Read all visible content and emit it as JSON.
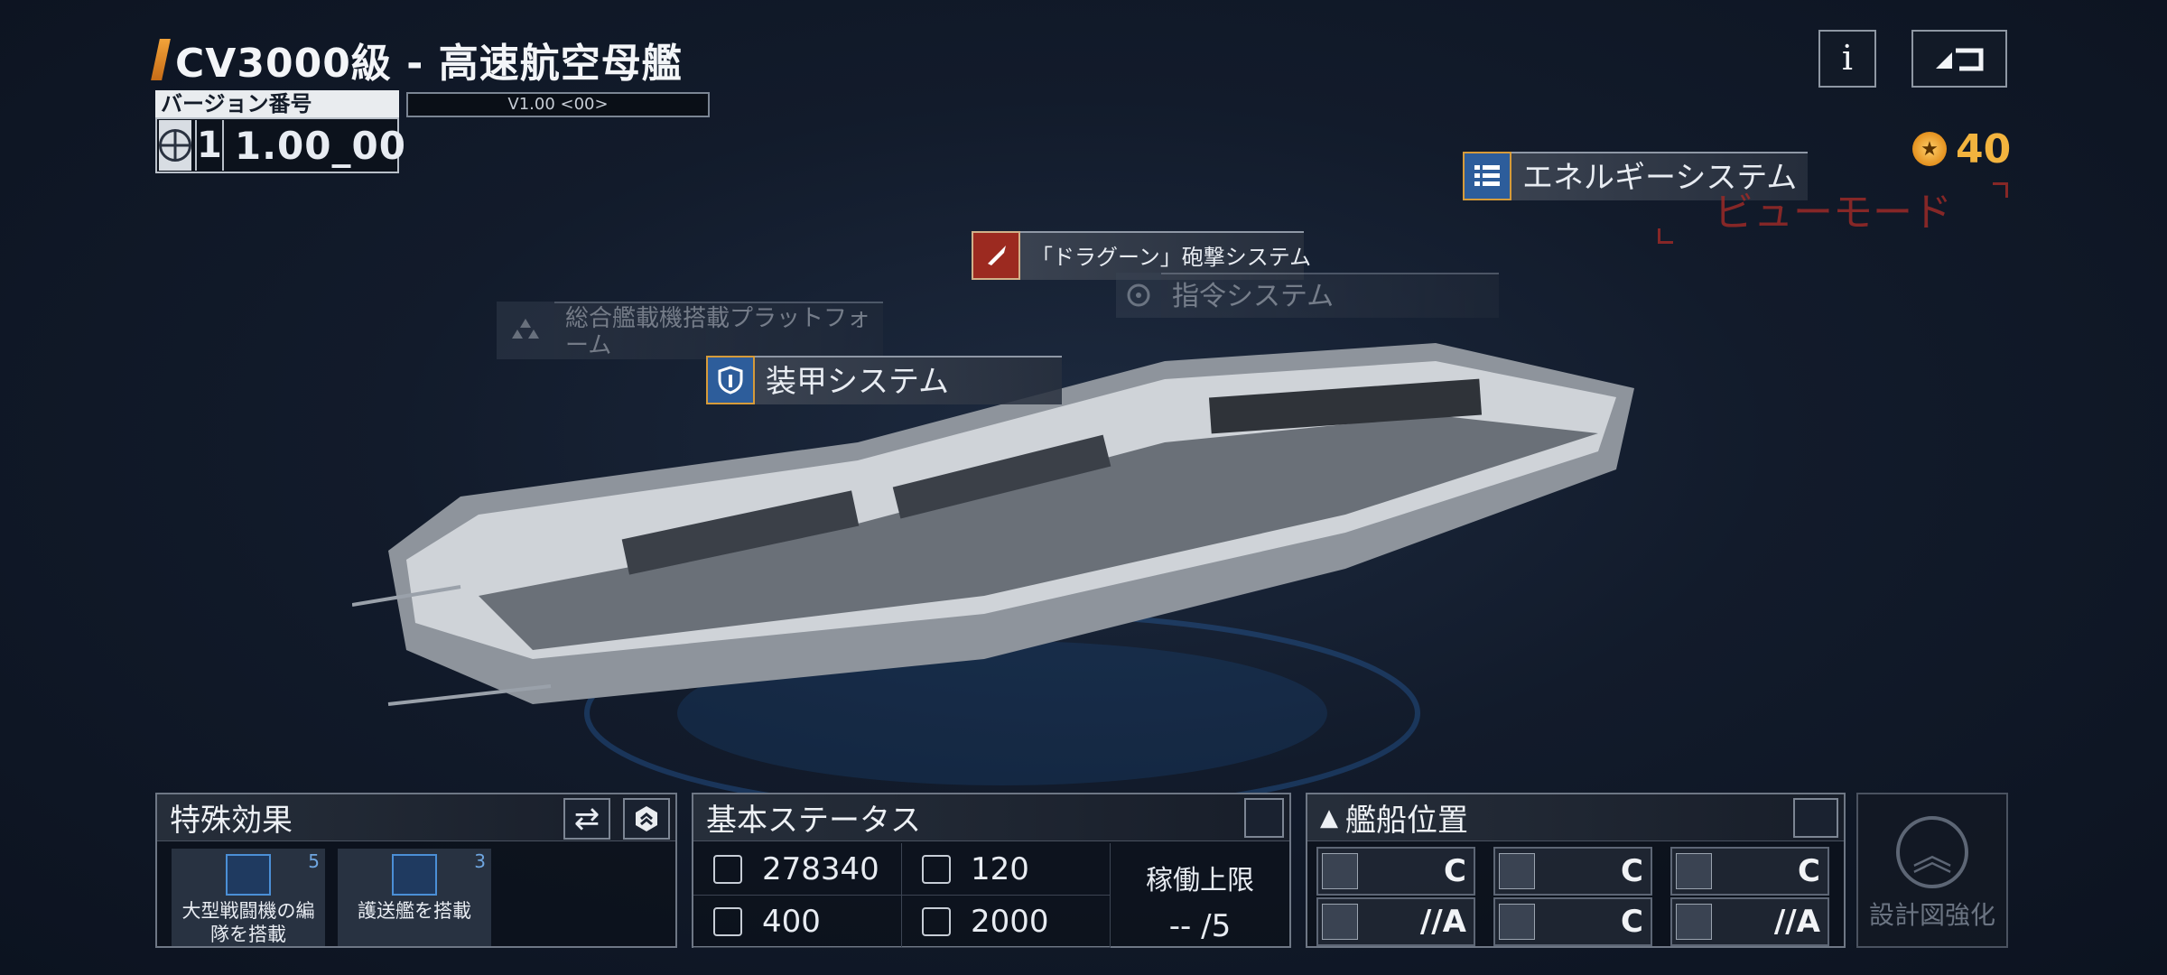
{
  "header": {
    "title": "CV3000級 - 高速航空母艦",
    "version_label": "バージョン番号",
    "version_major": "1",
    "version_minor": "1.00_00",
    "version_small": "V1.00 <00>"
  },
  "top_right": {
    "info_label": "i",
    "points": "40"
  },
  "callouts": {
    "energy": "エネルギーシステム",
    "dragoon": "「ドラグーン」砲撃システム",
    "command": "指令システム",
    "platform": "総合艦載機搭載プラットフォーム",
    "armor": "装甲システム"
  },
  "view_mode": "ビューモード",
  "special": {
    "title": "特殊効果",
    "effects": [
      {
        "count": "5",
        "text": "大型戦闘機の編隊を搭載"
      },
      {
        "count": "3",
        "text": "護送艦を搭載"
      }
    ]
  },
  "status": {
    "title": "基本ステータス",
    "hp": "278340",
    "speed": "120",
    "stat3": "400",
    "stat4": "2000",
    "op_limit_label": "稼働上限",
    "op_limit_value": "-- /5"
  },
  "position": {
    "title": "艦船位置",
    "grades": [
      "C",
      "C",
      "C",
      "//A",
      "C",
      "//A"
    ]
  },
  "enhance_label": "設計図強化",
  "colors": {
    "accent_orange": "#f2a33a",
    "points_gold": "#f2b33e",
    "view_mode_red": "#9b2a27",
    "system_blue": "#2d5d9b"
  }
}
